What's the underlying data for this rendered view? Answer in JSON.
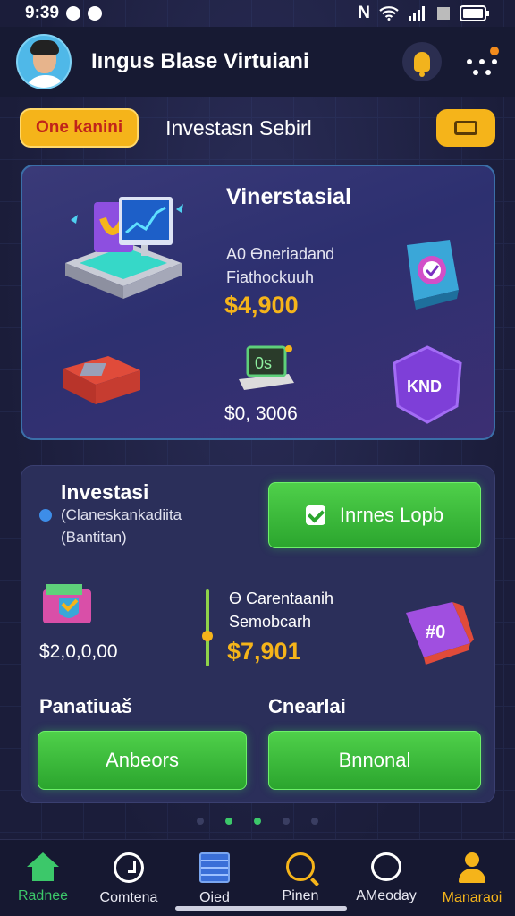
{
  "status_bar": {
    "time": "9:39",
    "app_icons": [
      "message-icon",
      "notification-icon"
    ],
    "right_icons": [
      "nfc-icon",
      "wifi-icon",
      "signal-icon",
      "sim-icon",
      "battery-icon"
    ]
  },
  "header": {
    "title": "Iıngus Blase Virtuiani"
  },
  "subbar": {
    "pill_label": "One kanini",
    "title": "Investasn Sebirl"
  },
  "card_top": {
    "heading": "Vinerstasial",
    "line1": "A0 Ɵneriadand",
    "line2": "Fiathockuuh",
    "price": "$4,900",
    "secondary_price": "$0, 3006",
    "cash_label": "0s",
    "hex_label": "KND"
  },
  "card_bottom": {
    "title": "Investasi",
    "line1": "(Claneskankadiita",
    "line2": "(Bantitan)",
    "primary_button": "Inrnes Lopb",
    "wallet_amount": "$2,0,0,00",
    "stat_line1": "Ɵ Carentaanih",
    "stat_line2": "Semobcarh",
    "stat_amount": "$7,901",
    "cube_label": "#0",
    "label_left": "Panatiuaš",
    "label_right": "Cnearlai",
    "button_left": "Anbeors",
    "button_right": "Bnnonal"
  },
  "bottom_nav": [
    {
      "label": "Radnee",
      "icon": "home-icon"
    },
    {
      "label": "Comtena",
      "icon": "clock-icon"
    },
    {
      "label": "Oied",
      "icon": "document-icon"
    },
    {
      "label": "Pinen",
      "icon": "search-icon"
    },
    {
      "label": "AMeoday",
      "icon": "chat-icon"
    },
    {
      "label": "Manaraoi",
      "icon": "user-icon"
    }
  ],
  "colors": {
    "accent_gold": "#f5b41a",
    "accent_green": "#3cc86a",
    "background": "#1c1f3d"
  }
}
